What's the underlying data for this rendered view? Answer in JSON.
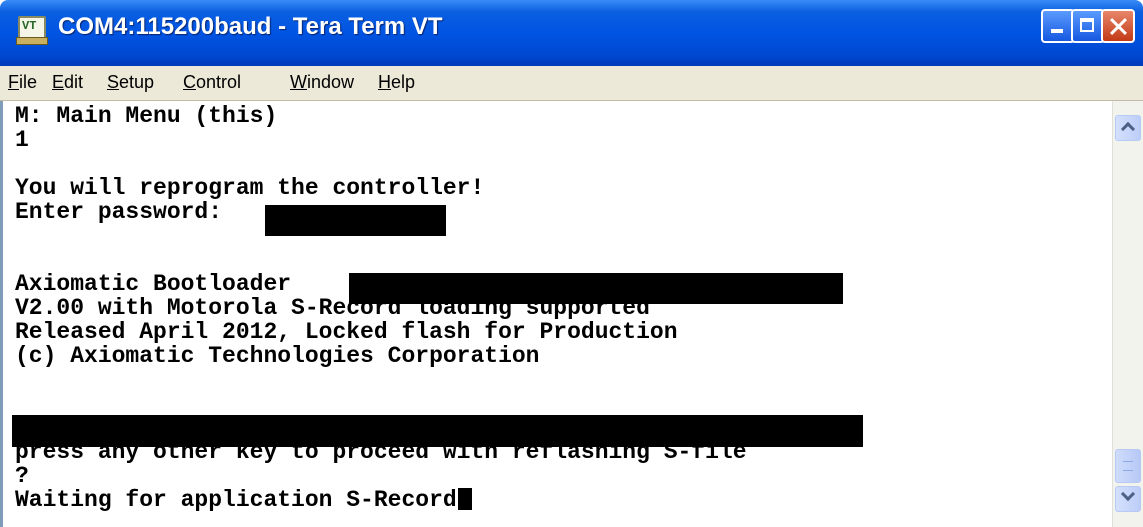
{
  "window": {
    "title": "COM4:115200baud - Tera Term VT",
    "app_icon_text": "VT"
  },
  "menubar": {
    "items": [
      "File",
      "Edit",
      "Setup",
      "Control",
      "Window",
      "Help"
    ]
  },
  "terminal": {
    "lines": [
      "M: Main Menu (this)",
      "1",
      "",
      "You will reprogram the controller!",
      "Enter password: ",
      "",
      "",
      "Axiomatic Bootloader ",
      "V2.00 with Motorola S-Record loading supported",
      "Released April 2012, Locked flash for Production",
      "(c) Axiomatic Technologies Corporation",
      "",
      "",
      "",
      "press any other key to proceed with reflashing S-file",
      "?",
      "Waiting for application S-Record"
    ]
  },
  "colors": {
    "titlebar": "#0054e3",
    "menubar": "#ece9d8",
    "terminal_bg": "#ffffff",
    "terminal_fg": "#000000",
    "close_button": "#c23a16"
  }
}
